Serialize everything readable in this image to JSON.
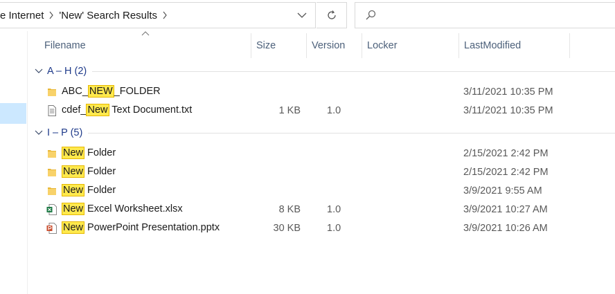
{
  "address": {
    "crumbs": [
      "e Internet",
      "'New' Search Results"
    ]
  },
  "search": {
    "placeholder": ""
  },
  "columns": {
    "filename": "Filename",
    "size": "Size",
    "version": "Version",
    "locker": "Locker",
    "modified": "LastModified"
  },
  "groups": [
    {
      "label": "A – H (2)"
    },
    {
      "label": "I – P (5)"
    }
  ],
  "rows": [
    {
      "pre": "ABC_",
      "hit": "NEW",
      "post": "_FOLDER",
      "type": "folder",
      "size": "",
      "version": "",
      "modified": "3/11/2021 10:35 PM"
    },
    {
      "pre": "cdef_",
      "hit": "New",
      "post": " Text Document.txt",
      "type": "text",
      "size": "1 KB",
      "version": "1.0",
      "modified": "3/11/2021 10:35 PM"
    },
    {
      "pre": "",
      "hit": "New",
      "post": " Folder",
      "type": "folder",
      "size": "",
      "version": "",
      "modified": "2/15/2021 2:42 PM"
    },
    {
      "pre": "",
      "hit": "New",
      "post": " Folder",
      "type": "folder",
      "size": "",
      "version": "",
      "modified": "2/15/2021 2:42 PM"
    },
    {
      "pre": "",
      "hit": "New",
      "post": " Folder",
      "type": "folder",
      "size": "",
      "version": "",
      "modified": "3/9/2021 9:55 AM"
    },
    {
      "pre": "",
      "hit": "New",
      "post": " Excel Worksheet.xlsx",
      "type": "excel",
      "size": "8 KB",
      "version": "1.0",
      "modified": "3/9/2021 10:27 AM"
    },
    {
      "pre": "",
      "hit": "New",
      "post": " PowerPoint Presentation.pptx",
      "type": "powerpoint",
      "size": "30 KB",
      "version": "1.0",
      "modified": "3/9/2021 10:26 AM"
    }
  ],
  "colors": {
    "highlight": "#ffe94d",
    "group_label": "#1e3a8a",
    "selection": "#cce8ff"
  }
}
